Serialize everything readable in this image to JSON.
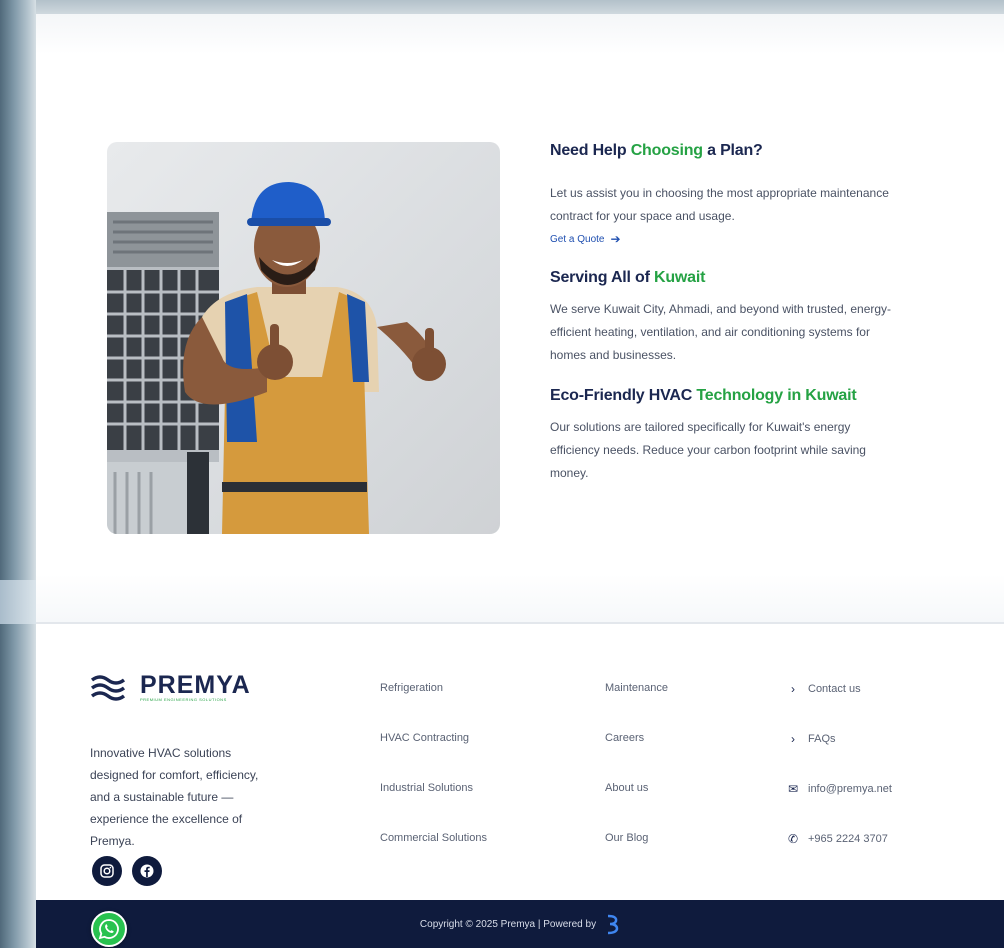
{
  "colors": {
    "navy": "#1b2750",
    "green": "#25a244",
    "footer_bg": "#0f1b3d",
    "link": "#1f4fb0"
  },
  "help": {
    "title_a": "Need Help ",
    "title_accent": "Choosing",
    "title_b": " a Plan?",
    "line1": "Let us assist you in choosing the most appropriate maintenance",
    "line2": "contract for your space and usage.",
    "cta": "Get a Quote",
    "cta_icon": "arrow-right-icon"
  },
  "serving": {
    "title_a": "Serving All of ",
    "title_accent": "Kuwait",
    "line1": "We serve Kuwait City, Ahmadi, and beyond with trusted, energy-",
    "line2": "efficient heating, ventilation, and air conditioning systems for",
    "line3": "homes and businesses."
  },
  "eco": {
    "title_a": "Eco-Friendly HVAC ",
    "title_accent": "Technology in Kuwait",
    "line1": "Our solutions are tailored specifically for Kuwait's energy",
    "line2": "efficiency needs. Reduce your carbon footprint while saving",
    "line3": "money."
  },
  "footer": {
    "logo": "PREMYA",
    "logo_tagline": "PREMIUM ENGINEERING SOLUTIONS",
    "about_l1": "Innovative HVAC solutions",
    "about_l2": "designed for comfort, efficiency,",
    "about_l3": "and a sustainable future —",
    "about_l4": "experience the excellence of",
    "about_l5": "Premya.",
    "col1": [
      "Refrigeration",
      "HVAC Contracting",
      "Industrial Solutions",
      "Commercial Solutions"
    ],
    "col2": [
      "Maintenance",
      "Careers",
      "About us",
      "Our Blog"
    ],
    "contact_us": "Contact us",
    "faqs": "FAQs",
    "email": "info@premya.net",
    "phone": "+965 2224 3707",
    "copyright": "Copyright © 2025 Premya | Powered by",
    "social_icons": [
      "instagram-icon",
      "facebook-icon"
    ]
  }
}
